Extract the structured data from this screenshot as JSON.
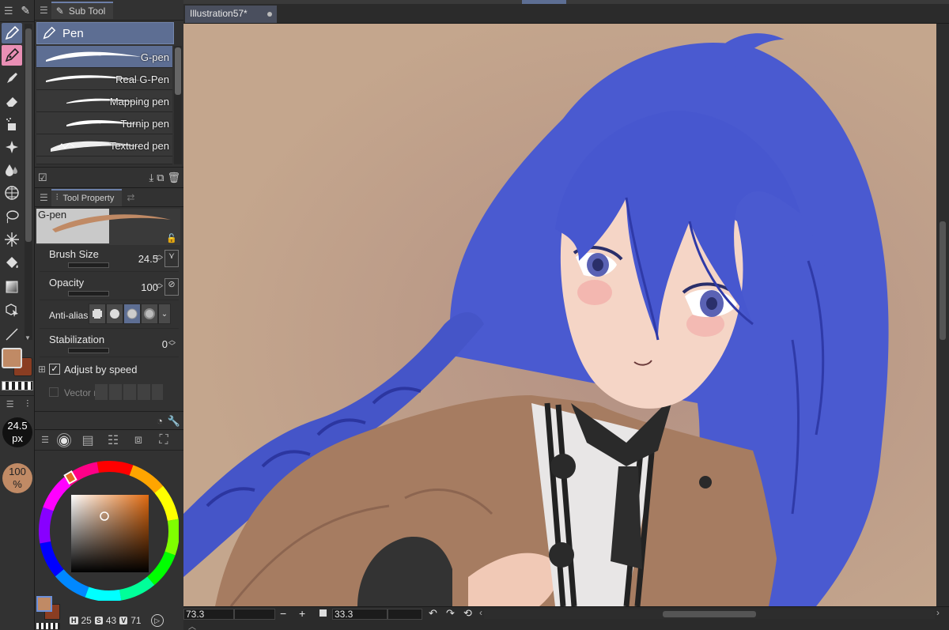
{
  "subtool_panel": {
    "title": "Sub Tool",
    "group": "Pen",
    "brushes": [
      {
        "label": "G-pen",
        "selected": true
      },
      {
        "label": "Real G-Pen",
        "selected": false
      },
      {
        "label": "Mapping pen",
        "selected": false
      },
      {
        "label": "Turnip pen",
        "selected": false
      },
      {
        "label": "Textured pen",
        "selected": false
      }
    ]
  },
  "tool_property": {
    "title": "Tool Property",
    "preset_name": "G-pen",
    "brush_size_label": "Brush Size",
    "brush_size_value": "24.5",
    "opacity_label": "Opacity",
    "opacity_value": "100",
    "antialias_label": "Anti-aliasi",
    "stabilization_label": "Stabilization",
    "stabilization_value": "0",
    "adjust_speed_label": "Adjust by speed",
    "adjust_speed_checked": true,
    "vector_label": "Vector m"
  },
  "indicators": {
    "size_value": "24.5",
    "size_unit": "px",
    "opacity_value": "100",
    "opacity_unit": "%"
  },
  "color": {
    "main": "#c08a65",
    "sub": "#8a3d22",
    "h_label": "H",
    "h_value": "25",
    "s_label": "S",
    "s_value": "43",
    "v_label": "V",
    "v_value": "71"
  },
  "document": {
    "tab_title": "Illustration57*"
  },
  "status": {
    "zoom": "73.3",
    "minus": "−",
    "plus": "+",
    "angle": "33.3"
  }
}
